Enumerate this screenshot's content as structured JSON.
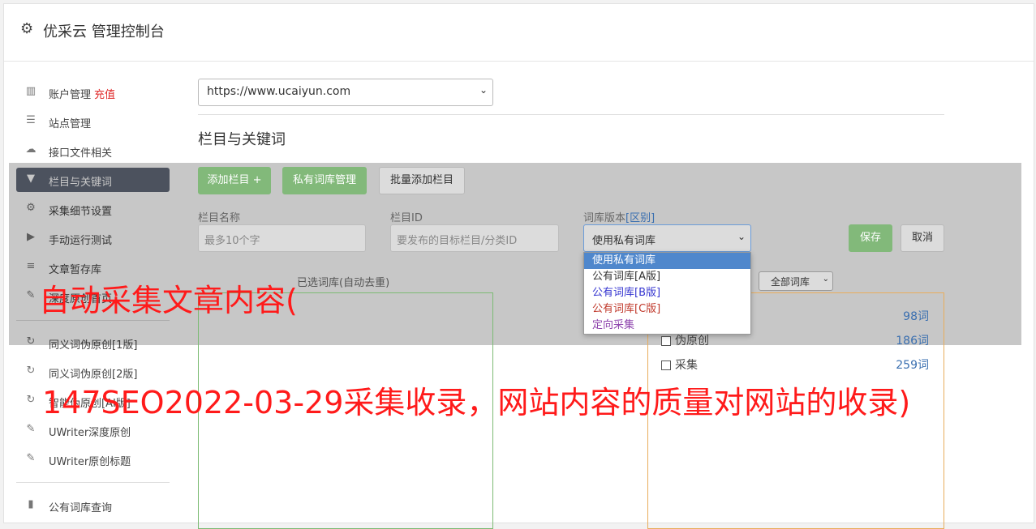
{
  "header": {
    "title": "优采云 管理控制台",
    "icon": "gear-icon"
  },
  "sidebar": {
    "items": [
      {
        "label": "账户管理",
        "badge": "充值",
        "icon": "bar-chart-icon"
      },
      {
        "label": "站点管理",
        "icon": "server-icon"
      },
      {
        "label": "接口文件相关",
        "icon": "cloud-upload-icon"
      },
      {
        "label": "栏目与关键词",
        "icon": "filter-icon",
        "active": true
      },
      {
        "label": "采集细节设置",
        "icon": "cogs-icon"
      },
      {
        "label": "手动运行测试",
        "icon": "play-circle-icon"
      },
      {
        "label": "文章暂存库",
        "icon": "database-icon"
      },
      {
        "label": "深度原创首页",
        "icon": "edit-icon"
      },
      {
        "label": "同义词伪原创[1版]",
        "icon": "refresh-icon"
      },
      {
        "label": "同义词伪原创[2版]",
        "icon": "refresh-icon"
      },
      {
        "label": "智能伪原创[AI版]",
        "icon": "refresh-icon"
      },
      {
        "label": "UWriter深度原创",
        "icon": "edit-icon"
      },
      {
        "label": "UWriter原创标题",
        "icon": "edit-icon"
      },
      {
        "label": "公有词库查询",
        "icon": "book-icon"
      }
    ]
  },
  "main": {
    "site_select": "https://www.ucaiyun.com",
    "section_title": "栏目与关键词",
    "buttons": {
      "add_column": "添加栏目 +",
      "private_lib": "私有词库管理",
      "batch_add": "批量添加栏目",
      "save": "保存",
      "cancel": "取消"
    },
    "form": {
      "name_label": "栏目名称",
      "name_placeholder": "最多10个字",
      "id_label": "栏目ID",
      "id_placeholder": "要发布的目标栏目/分类ID",
      "version_label": "词库版本",
      "version_link": "[区别]",
      "version_value": "使用私有词库"
    },
    "dropdown_options": [
      {
        "label": "使用私有词库",
        "color": "#ffffff",
        "selected": true
      },
      {
        "label": "公有词库[A版]",
        "color": "#333333"
      },
      {
        "label": "公有词库[B版]",
        "color": "#3535d0"
      },
      {
        "label": "公有词库[C版]",
        "color": "#c0392b"
      },
      {
        "label": "定向采集",
        "color": "#8e44ad"
      }
    ],
    "selected_label": "已选词库(自动去重)",
    "filter_select": "全部词库",
    "lib_rows": [
      {
        "label": "",
        "count": "98词"
      },
      {
        "label": "伪原创",
        "count": "186词"
      },
      {
        "label": "采集",
        "count": "259词"
      }
    ]
  },
  "watermark": {
    "line1": "自动采集文章内容(",
    "line2": "147SEO2022-03-29采集收录，网站内容的质量对网站的收录)"
  }
}
